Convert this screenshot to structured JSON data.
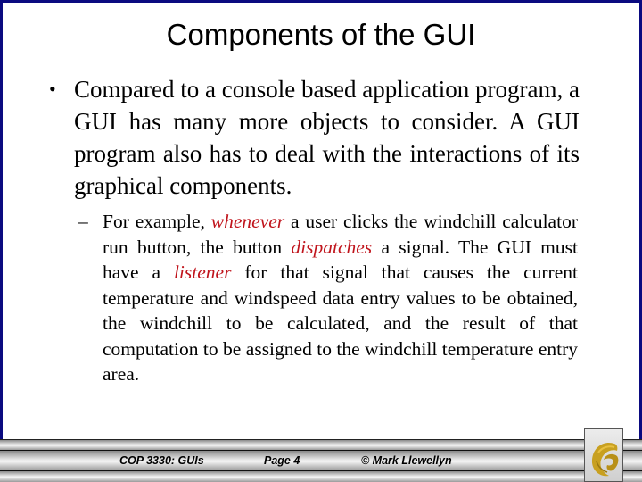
{
  "slide": {
    "title": "Components of the GUI",
    "bullet": {
      "marker": "•",
      "text": "Compared to a console based application program, a GUI has many more objects to consider.  A GUI program also has to deal with the interactions of its graphical components."
    },
    "sub_bullet": {
      "marker": "–",
      "segments": [
        {
          "text": "For example, ",
          "emphasis": false
        },
        {
          "text": "whenever",
          "emphasis": true
        },
        {
          "text": " a user clicks the windchill calculator run button, the button ",
          "emphasis": false
        },
        {
          "text": "dispatches",
          "emphasis": true
        },
        {
          "text": " a signal.  The GUI must have a ",
          "emphasis": false
        },
        {
          "text": "listener",
          "emphasis": true
        },
        {
          "text": " for that signal that causes the current temperature and windspeed data entry values to be obtained, the windchill to be calculated, and the result of that computation to be assigned to the windchill temperature entry area.",
          "emphasis": false
        }
      ]
    },
    "emphasis_color": "#c0141c",
    "border_color": "#0a0a80"
  },
  "footer": {
    "course": "COP 3330:  GUIs",
    "page": "Page 4",
    "copyright": "© Mark Llewellyn",
    "logo": "ucf-pegasus-logo-icon"
  }
}
